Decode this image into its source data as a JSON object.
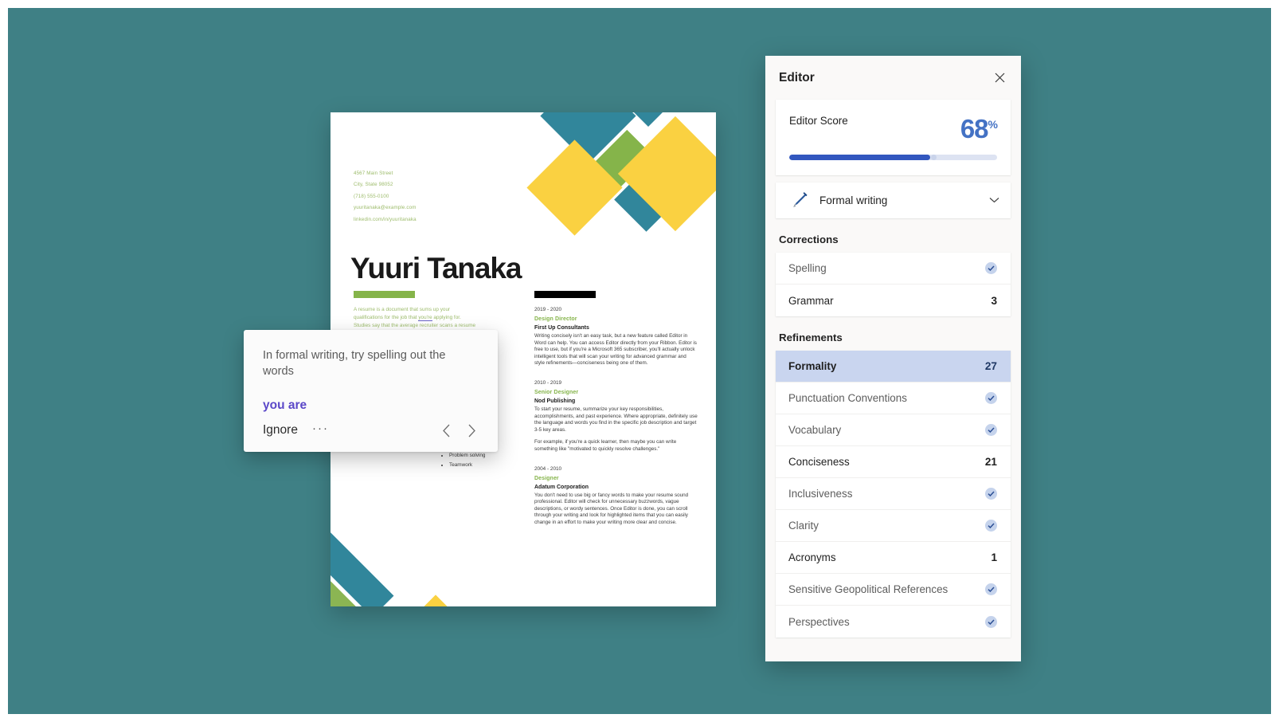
{
  "background_color": "#3f8085",
  "editor_panel": {
    "title": "Editor",
    "close_icon": "close-icon",
    "score": {
      "label": "Editor Score",
      "value": "68",
      "unit": "%",
      "percent": 68,
      "fill_color": "#3257bf",
      "track_color": "#dde3f2"
    },
    "writing_style": {
      "icon": "pen-icon",
      "label": "Formal writing",
      "chevron_icon": "chevron-down-icon"
    },
    "corrections": {
      "heading": "Corrections",
      "items": [
        {
          "label": "Spelling",
          "count": null,
          "state": "clear"
        },
        {
          "label": "Grammar",
          "count": "3",
          "state": "issues"
        }
      ]
    },
    "refinements": {
      "heading": "Refinements",
      "items": [
        {
          "label": "Formality",
          "count": "27",
          "state": "issues",
          "selected": true
        },
        {
          "label": "Punctuation Conventions",
          "count": null,
          "state": "clear",
          "selected": false
        },
        {
          "label": "Vocabulary",
          "count": null,
          "state": "clear",
          "selected": false
        },
        {
          "label": "Conciseness",
          "count": "21",
          "state": "issues",
          "selected": false
        },
        {
          "label": "Inclusiveness",
          "count": null,
          "state": "clear",
          "selected": false
        },
        {
          "label": "Clarity",
          "count": null,
          "state": "clear",
          "selected": false
        },
        {
          "label": "Acronyms",
          "count": "1",
          "state": "issues",
          "selected": false
        },
        {
          "label": "Sensitive Geopolitical References",
          "count": null,
          "state": "clear",
          "selected": false
        },
        {
          "label": "Perspectives",
          "count": null,
          "state": "clear",
          "selected": false
        }
      ]
    }
  },
  "suggestion_card": {
    "message": "In formal writing, try spelling out the words",
    "replacement": "you are",
    "ignore_label": "Ignore",
    "more_label": "···",
    "prev_icon": "chevron-left-icon",
    "next_icon": "chevron-right-icon"
  },
  "document": {
    "name": "Yuuri Tanaka",
    "contact": [
      "4567 Main Street",
      "City, State 98052",
      "(718) 555-0100",
      "yuuritanaka@example.com",
      "linkedin.com/in/yuuritanaka"
    ],
    "summary_line1": "A resume is a document that sums up your",
    "summary_line2a": "qualifications for the job that ",
    "summary_line2b": "you're",
    "summary_line2c": " applying for.",
    "summary_line3": "Studies say that the average recruiter scans a resume",
    "skills": [
      "Problem solving",
      "Teamwork"
    ],
    "jobs": [
      {
        "dates": "2019 - 2020",
        "title": "Design Director",
        "company": "First Up Consultants",
        "paragraphs": [
          "Writing concisely isn't an easy task, but a new feature called Editor in Word can help. You can access Editor directly from your Ribbon. Editor is free to use, but if you're a Microsoft 365 subscriber, you'll actually unlock intelligent tools that will scan your writing for advanced grammar and style refinements—conciseness being one of them."
        ]
      },
      {
        "dates": "2010 - 2019",
        "title": "Senior Designer",
        "company": "Nod Publishing",
        "paragraphs": [
          "To start your resume, summarize your key responsibilities, accomplishments, and past experience. Where appropriate, definitely use the language and words you find in the specific job description and target 3-5 key areas.",
          "For example, if you're a quick learner, then maybe you can write something like \"motivated to quickly resolve challenges.\""
        ]
      },
      {
        "dates": "2004 - 2010",
        "title": "Designer",
        "company": "Adatum Corporation",
        "paragraphs": [
          "You don't need to use big or fancy words to make your resume sound professional. Editor will check for unnecessary buzzwords, vague descriptions, or wordy sentences. Once Editor is done, you can scroll through your writing and look for highlighted items that you can easily change in an effort to make your writing more clear and concise."
        ]
      }
    ],
    "accent_colors": {
      "teal": "#31869b",
      "yellow": "#fad141",
      "green": "#85b44a"
    }
  }
}
